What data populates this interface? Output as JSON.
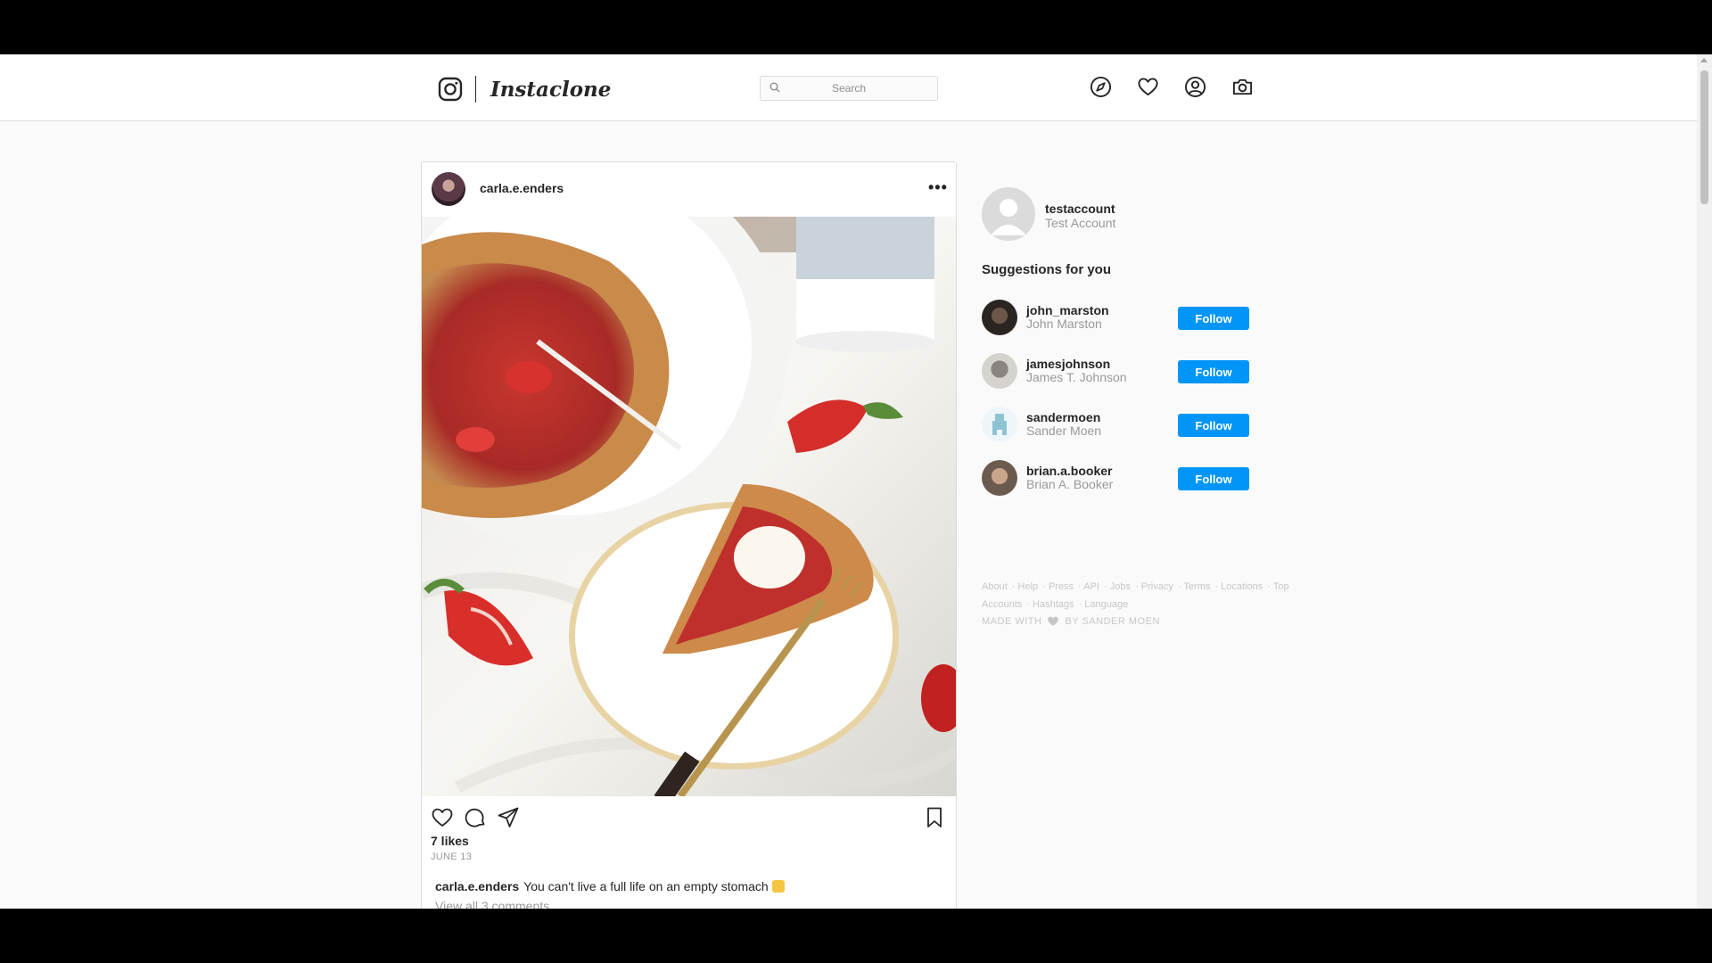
{
  "app": {
    "name": "Instaclone",
    "icons": {
      "logo": "instagram-logo-icon",
      "explore": "compass-icon",
      "activity": "heart-icon",
      "profile": "user-circle-icon",
      "camera": "camera-icon"
    },
    "accent": "#0095f6"
  },
  "search": {
    "placeholder": "Search",
    "value": ""
  },
  "post": {
    "username": "carla.e.enders",
    "menu_label": "•••",
    "image_alt": "Strawberry galette on plates with fork and strawberries",
    "likes": "7 likes",
    "date": "JUNE 13",
    "caption_user": "carla.e.enders",
    "caption_text": "You can't live a full life on an empty stomach",
    "view_comments": "View all 3 comments"
  },
  "sidebar": {
    "me": {
      "username": "testaccount",
      "name": "Test Account"
    },
    "suggestions_title": "Suggestions for you",
    "suggestions": [
      {
        "username": "john_marston",
        "name": "John Marston",
        "button": "Follow",
        "avatar_color": "#2b2522"
      },
      {
        "username": "jamesjohnson",
        "name": "James T. Johnson",
        "button": "Follow",
        "avatar_color": "#b8b4ae"
      },
      {
        "username": "sandermoen",
        "name": "Sander Moen",
        "button": "Follow",
        "avatar_color": "#8ec3d6"
      },
      {
        "username": "brian.a.booker",
        "name": "Brian A. Booker",
        "button": "Follow",
        "avatar_color": "#6b5a4e"
      }
    ],
    "footer_links": [
      "About",
      "Help",
      "Press",
      "API",
      "Jobs",
      "Privacy",
      "Terms",
      "Locations",
      "Top Accounts",
      "Hashtags",
      "Language"
    ],
    "made_with_prefix": "MADE WITH",
    "made_with_suffix": "BY SANDER MOEN"
  }
}
